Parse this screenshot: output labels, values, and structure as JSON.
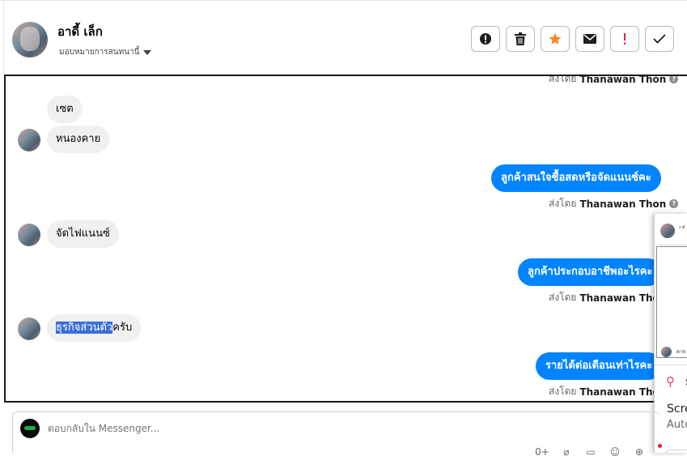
{
  "contact": {
    "name": "อาดี้ เล็ก",
    "assign_label": "มอบหมายการสนทนานี้"
  },
  "actions": [
    {
      "name": "report-spam-button",
      "icon": "exclamation-circle-icon",
      "color": "#1c1e21"
    },
    {
      "name": "delete-button",
      "icon": "trash-icon",
      "color": "#1c1e21"
    },
    {
      "name": "star-button",
      "icon": "star-icon",
      "color": "#f5862b"
    },
    {
      "name": "mark-unread-button",
      "icon": "envelope-icon",
      "color": "#1c1e21"
    },
    {
      "name": "flag-important-button",
      "icon": "exclamation-icon",
      "color": "#e41e3f"
    },
    {
      "name": "mark-done-button",
      "icon": "check-icon",
      "color": "#1c1e21"
    }
  ],
  "conversation": {
    "sent_by_prefix": "ส่งโดย",
    "sender": "Thanawan Thon",
    "messages": [
      {
        "side": "in",
        "text": "เซต"
      },
      {
        "side": "in",
        "text": "หนองคาย"
      },
      {
        "side": "out",
        "text": "ลูกค้าสนใจซื้อสดหรือจัดแนนซ์คะ"
      },
      {
        "side": "in",
        "text": "จัดไฟแนนซ์"
      },
      {
        "side": "out",
        "text": "ลูกค้าประกอบอาชีพอะไรคะ"
      },
      {
        "side": "in",
        "text_selected": "ธุรกิจส่วนตัว",
        "text_rest": "ครับ"
      },
      {
        "side": "out",
        "text": "รายได้ต่อเดือนเท่าไรคะ"
      }
    ]
  },
  "popup": {
    "header_text": "อาดี้",
    "footer_text": "ดาห",
    "card_title": "S",
    "card_line1": "Scre",
    "card_line2": "Auto"
  },
  "composer": {
    "placeholder": "ตอบกลับใน Messenger...",
    "tools": [
      "0+",
      "⌀",
      "▭",
      "☺",
      "⊕"
    ]
  },
  "colors": {
    "accent": "#0084ff",
    "bubble_in": "#f0f0f0",
    "selection": "#3a6fd8"
  }
}
